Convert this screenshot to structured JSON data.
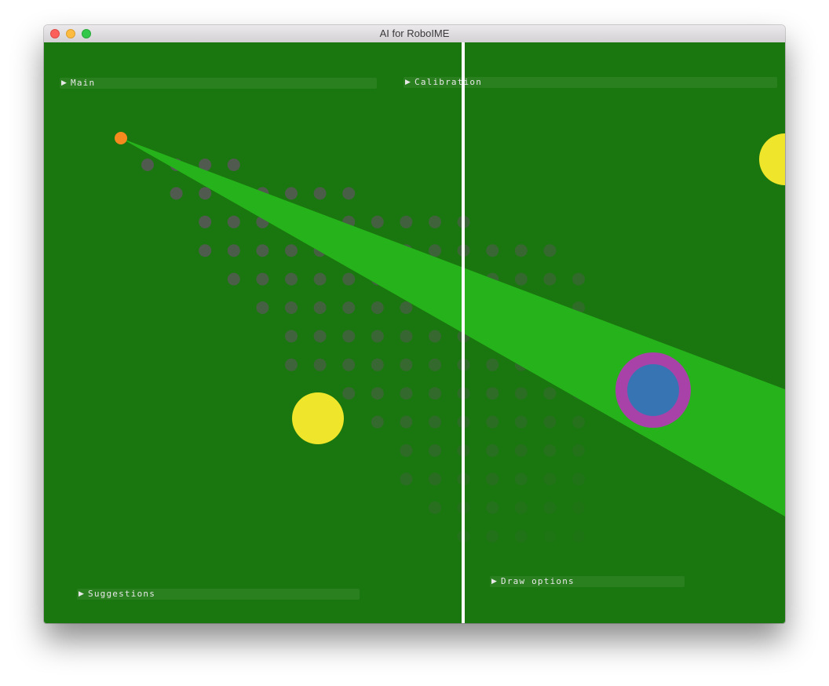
{
  "window": {
    "title": "AI for RoboIME"
  },
  "panels": {
    "main": {
      "label": "Main",
      "arrow": "▶"
    },
    "calibration": {
      "label": "Calibration",
      "arrow": "▶"
    },
    "suggestions": {
      "label": "Suggestions",
      "arrow": "▶"
    },
    "draw_options": {
      "label": "Draw options",
      "arrow": "▶"
    }
  },
  "colors": {
    "field": "#1a770f",
    "cone": "#26b21b",
    "ball": "#f68a1e",
    "yellow_robot": "#efe52a",
    "blue_robot": "#3774b4",
    "robot_ring": "#a842a8",
    "grid_dot": "#575757",
    "center_line": "#ffffff"
  }
}
